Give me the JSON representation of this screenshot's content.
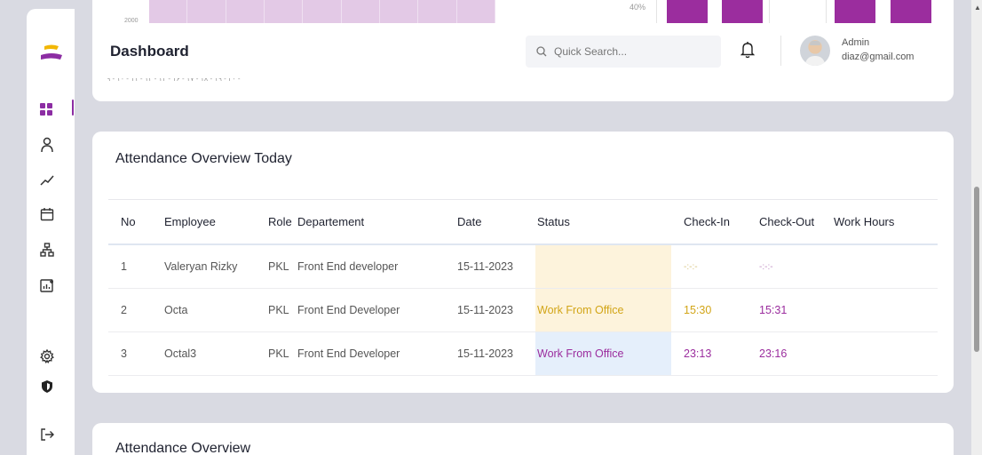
{
  "header": {
    "title": "Dashboard",
    "search_placeholder": "Quick Search...",
    "user_role": "Admin",
    "user_email": "diaz@gmail.com"
  },
  "chart_remnant": {
    "percent_label": "40%",
    "axis_ticks": "۹ -  ۱۰ -  ۱۱ -  ۱۲ -  ۱۳ -  ۱۶ -  ۱۷ -  ۱۸ -  ۱۹ -  ۲۰ -",
    "top_tick": "2000"
  },
  "attendance_today": {
    "title": "Attendance Overview Today",
    "columns": [
      "No",
      "Employee",
      "Role",
      "Departement",
      "Date",
      "Status",
      "Check-In",
      "Check-Out",
      "Work Hours"
    ],
    "rows": [
      {
        "no": "1",
        "employee": "Valeryan Rizky",
        "role": "PKL",
        "department": "Front End developer",
        "date": "15-11-2023",
        "status": "",
        "check_in": "-:-:-",
        "check_out": "-:-:-",
        "work_hours": ""
      },
      {
        "no": "2",
        "employee": "Octa",
        "role": "PKL",
        "department": "Front End Developer",
        "date": "15-11-2023",
        "status": "Work From Office",
        "check_in": "15:30",
        "check_out": "15:31",
        "work_hours": ""
      },
      {
        "no": "3",
        "employee": "Octal3",
        "role": "PKL",
        "department": "Front End Developer",
        "date": "15-11-2023",
        "status": "Work From Office",
        "check_in": "23:13",
        "check_out": "23:16",
        "work_hours": ""
      }
    ]
  },
  "attendance_overview": {
    "title": "Attendance Overview"
  },
  "sidebar": {
    "items": [
      {
        "icon": "grid-icon"
      },
      {
        "icon": "user-icon"
      },
      {
        "icon": "trend-icon"
      },
      {
        "icon": "calendar-icon"
      },
      {
        "icon": "hierarchy-icon"
      },
      {
        "icon": "chart-add-icon"
      },
      {
        "icon": "settings-icon"
      },
      {
        "icon": "shield-icon"
      },
      {
        "icon": "logout-icon"
      }
    ]
  },
  "colors": {
    "accent": "#9b2d9e",
    "status_yellow_bg": "#fdf3dc",
    "status_blue_bg": "#e5effb",
    "status_yellow_text": "#d2a517"
  }
}
